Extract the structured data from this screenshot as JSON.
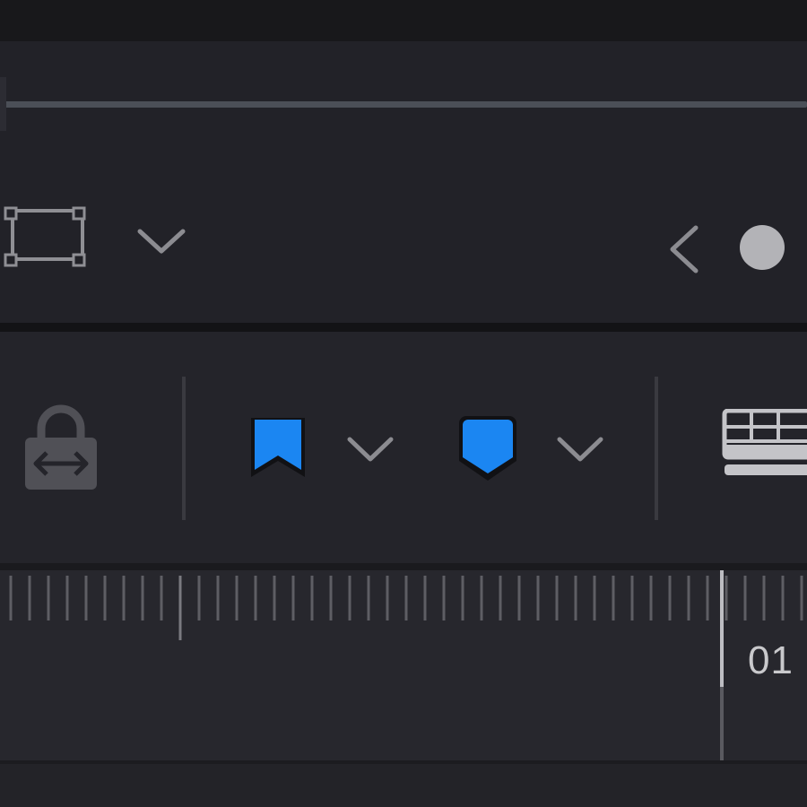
{
  "viewer_toolbar": {
    "transform_icon": "transform-rect-icon",
    "transform_menu_icon": "chevron-down-icon",
    "prev_icon": "chevron-left-icon",
    "record_icon": "circle-dot-icon"
  },
  "timeline_toolbar": {
    "lock_icon": "position-lock-icon",
    "flag_icon": "flag-icon",
    "flag_color": "#1b86f2",
    "flag_menu_icon": "chevron-down-icon",
    "marker_icon": "marker-icon",
    "marker_color": "#1b86f2",
    "marker_menu_icon": "chevron-down-icon",
    "view_options_icon": "timeline-view-options-icon"
  },
  "ruler": {
    "timecode": "01"
  }
}
